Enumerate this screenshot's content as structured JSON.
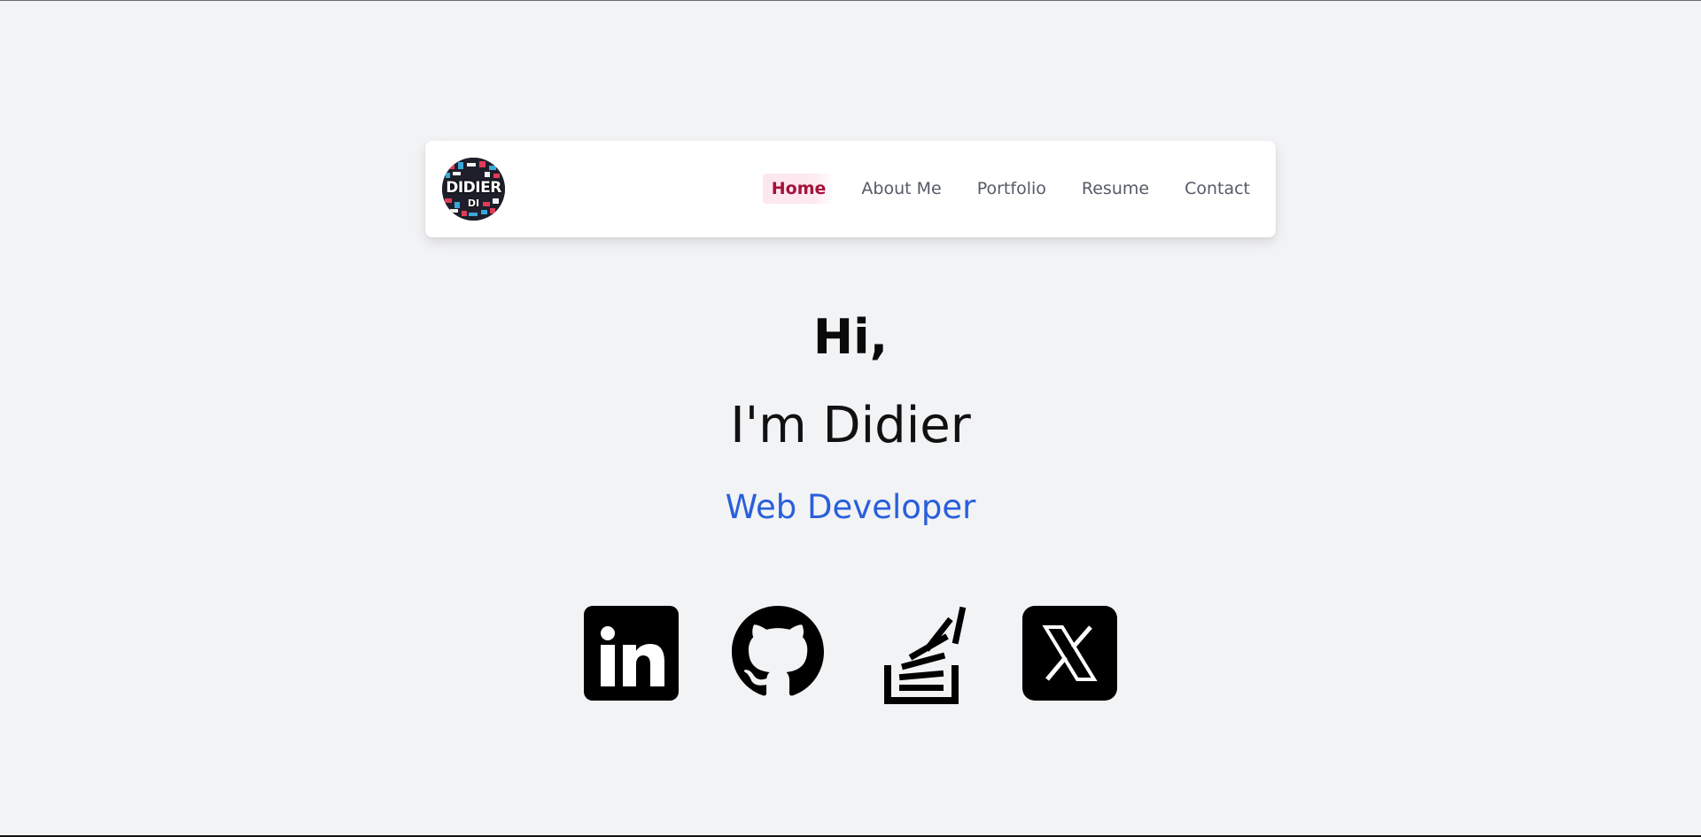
{
  "navbar": {
    "logo": {
      "text": "DIDIER",
      "sub_text": "DI"
    },
    "links": [
      {
        "label": "Home",
        "active": true
      },
      {
        "label": "About Me",
        "active": false
      },
      {
        "label": "Portfolio",
        "active": false
      },
      {
        "label": "Resume",
        "active": false
      },
      {
        "label": "Contact",
        "active": false
      }
    ]
  },
  "hero": {
    "greeting": "Hi,",
    "intro": "I'm Didier",
    "role": "Web Developer"
  },
  "social": [
    {
      "icon": "linkedin-icon"
    },
    {
      "icon": "github-icon"
    },
    {
      "icon": "stackoverflow-icon"
    },
    {
      "icon": "x-twitter-icon"
    }
  ],
  "colors": {
    "background": "#f2f3f5",
    "nav_active_text": "#a3123a",
    "nav_active_bg": "#fde7ef",
    "nav_text": "#555b66",
    "role_text": "#2a5fdc"
  }
}
